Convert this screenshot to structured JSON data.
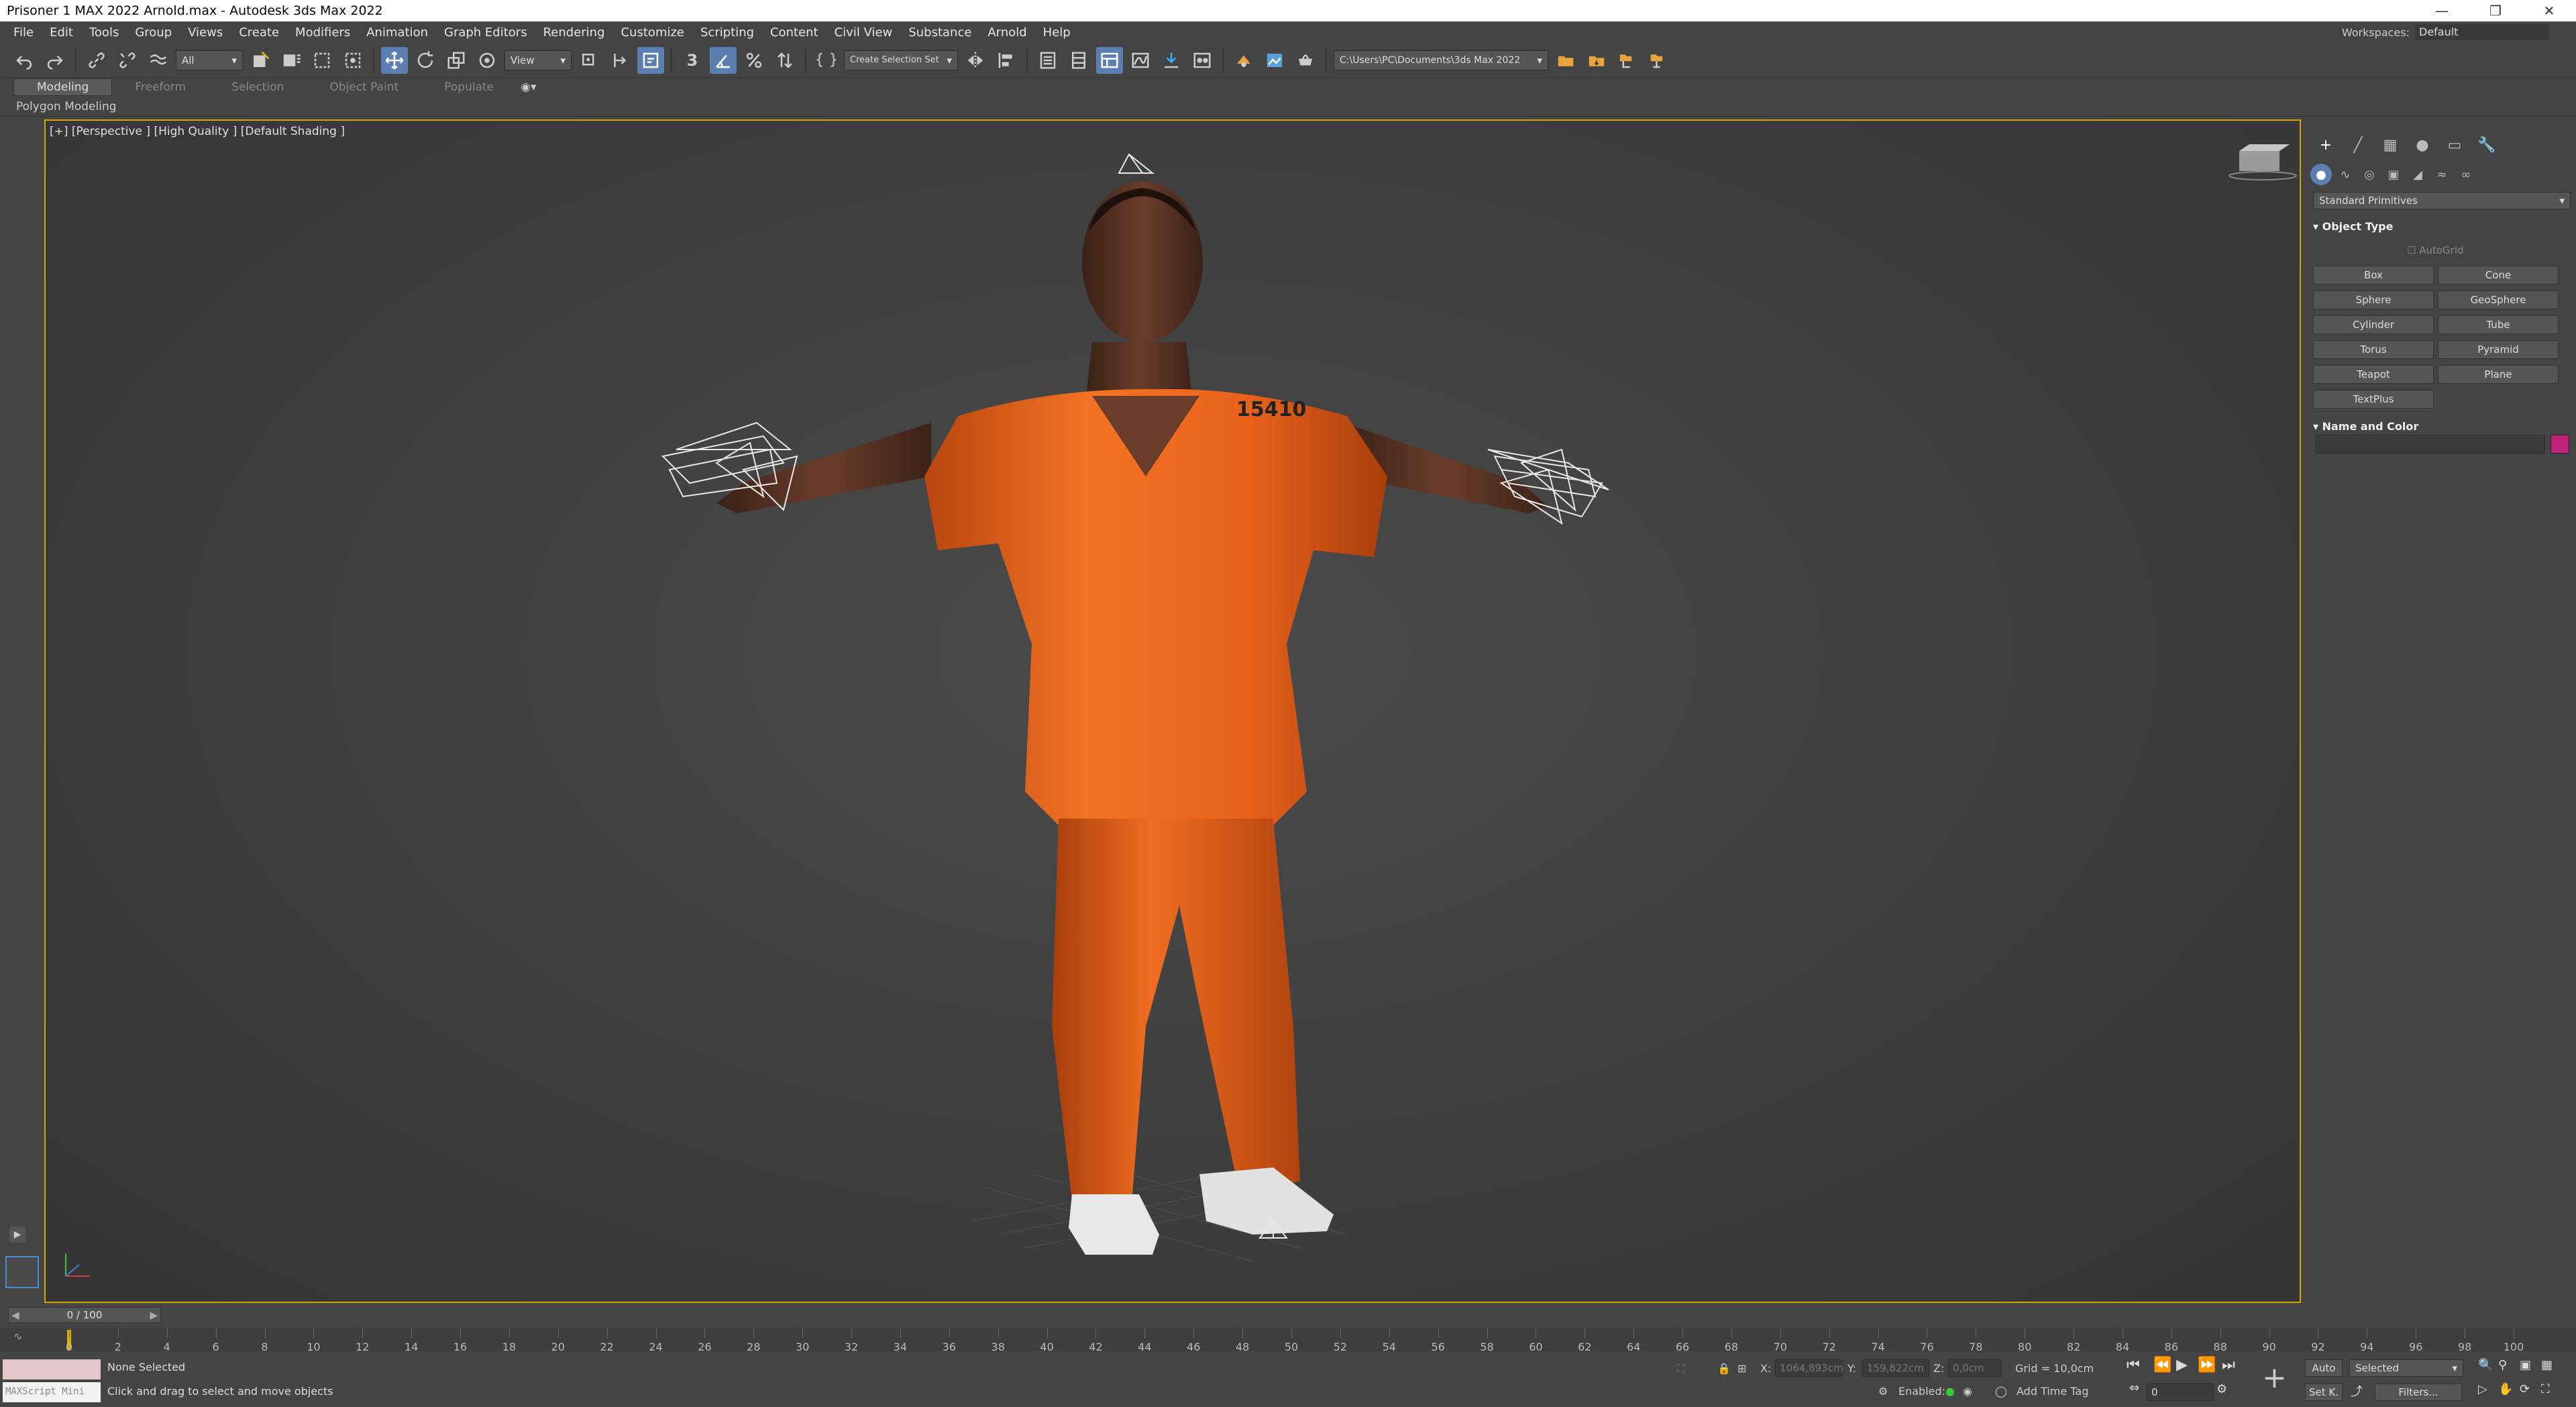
{
  "window": {
    "title": "Prisoner 1 MAX 2022 Arnold.max - Autodesk 3ds Max 2022",
    "controls": [
      "minimize-icon",
      "restore-icon",
      "close-icon"
    ]
  },
  "menu": {
    "items": [
      "File",
      "Edit",
      "Tools",
      "Group",
      "Views",
      "Create",
      "Modifiers",
      "Animation",
      "Graph Editors",
      "Rendering",
      "Customize",
      "Scripting",
      "Content",
      "Civil View",
      "Substance",
      "Arnold",
      "Help"
    ],
    "workspaces_label": "Workspaces:",
    "workspaces_value": "Default"
  },
  "toolbar": {
    "selection_filter": "All",
    "ref_coord": "View",
    "snap_label": "3",
    "selection_set": "Create Selection Set",
    "project_path": "C:\\Users\\PC\\Documents\\3ds Max 2022"
  },
  "ribbon": {
    "tabs": [
      "Modeling",
      "Freeform",
      "Selection",
      "Object Paint",
      "Populate"
    ],
    "active_tab": "Modeling",
    "panel_label": "Polygon Modeling"
  },
  "viewport": {
    "label": "[+] [Perspective ] [High Quality ] [Default Shading ]",
    "shirt_number": "15410",
    "colors": {
      "jumpsuit": "#f0691e",
      "skin": "#5a3424",
      "shoes": "#e8e8e8",
      "active_border": "#d8a200"
    }
  },
  "command_panel": {
    "tabs": [
      "create-icon",
      "modify-icon",
      "hierarchy-icon",
      "motion-icon",
      "display-icon",
      "utilities-icon"
    ],
    "categories": [
      "geometry-icon",
      "shapes-icon",
      "lights-icon",
      "cameras-icon",
      "helpers-icon",
      "spacewarps-icon",
      "systems-icon"
    ],
    "primitive_type": "Standard Primitives",
    "object_type_title": "Object Type",
    "autogrid_label": "AutoGrid",
    "buttons": [
      "Box",
      "Cone",
      "Sphere",
      "GeoSphere",
      "Cylinder",
      "Tube",
      "Torus",
      "Pyramid",
      "Teapot",
      "Plane",
      "TextPlus"
    ],
    "name_color_title": "Name and Color",
    "object_color": "#c0247a"
  },
  "timeline": {
    "slider_text": "0 / 100",
    "ticks": [
      "0",
      "2",
      "4",
      "6",
      "8",
      "10",
      "12",
      "14",
      "16",
      "18",
      "20",
      "22",
      "24",
      "26",
      "28",
      "30",
      "32",
      "34",
      "36",
      "38",
      "40",
      "42",
      "44",
      "46",
      "48",
      "50",
      "52",
      "54",
      "56",
      "58",
      "60",
      "62",
      "64",
      "66",
      "68",
      "70",
      "72",
      "74",
      "76",
      "78",
      "80",
      "82",
      "84",
      "86",
      "88",
      "90",
      "92",
      "94",
      "96",
      "98",
      "100"
    ]
  },
  "status": {
    "maxscript_label": "MAXScript Mini",
    "selection_status": "None Selected",
    "prompt": "Click and drag to select and move objects",
    "x_label": "X:",
    "x_value": "1064,893cm",
    "y_label": "Y:",
    "y_value": "159,822cm",
    "z_label": "Z:",
    "z_value": "0,0cm",
    "grid": "Grid = 10,0cm",
    "enabled_label": "Enabled:",
    "add_time_tag": "Add Time Tag",
    "auto_label": "Auto",
    "setk_label": "Set K.",
    "key_mode": "Selected",
    "frame_value": "0",
    "filters_label": "Filters..."
  }
}
